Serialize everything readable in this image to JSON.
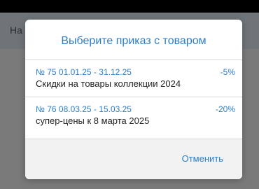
{
  "app": {
    "header_label": "Ha"
  },
  "dialog": {
    "title": "Выберите приказ с товаром",
    "orders": [
      {
        "meta": "№ 75  01.01.25 - 31.12.25",
        "discount": "-5%",
        "description": "Скидки на товары коллекции 2024"
      },
      {
        "meta": "№ 76  08.03.25 - 15.03.25",
        "discount": "-20%",
        "description": "супер-цены к 8 марта 2025"
      }
    ],
    "cancel_label": "Отменить"
  },
  "colors": {
    "accent": "#2d7ec8",
    "scrim": "#7a7a7a",
    "dialog_background": "#ffffff",
    "footer_background": "#f2f2f2"
  }
}
